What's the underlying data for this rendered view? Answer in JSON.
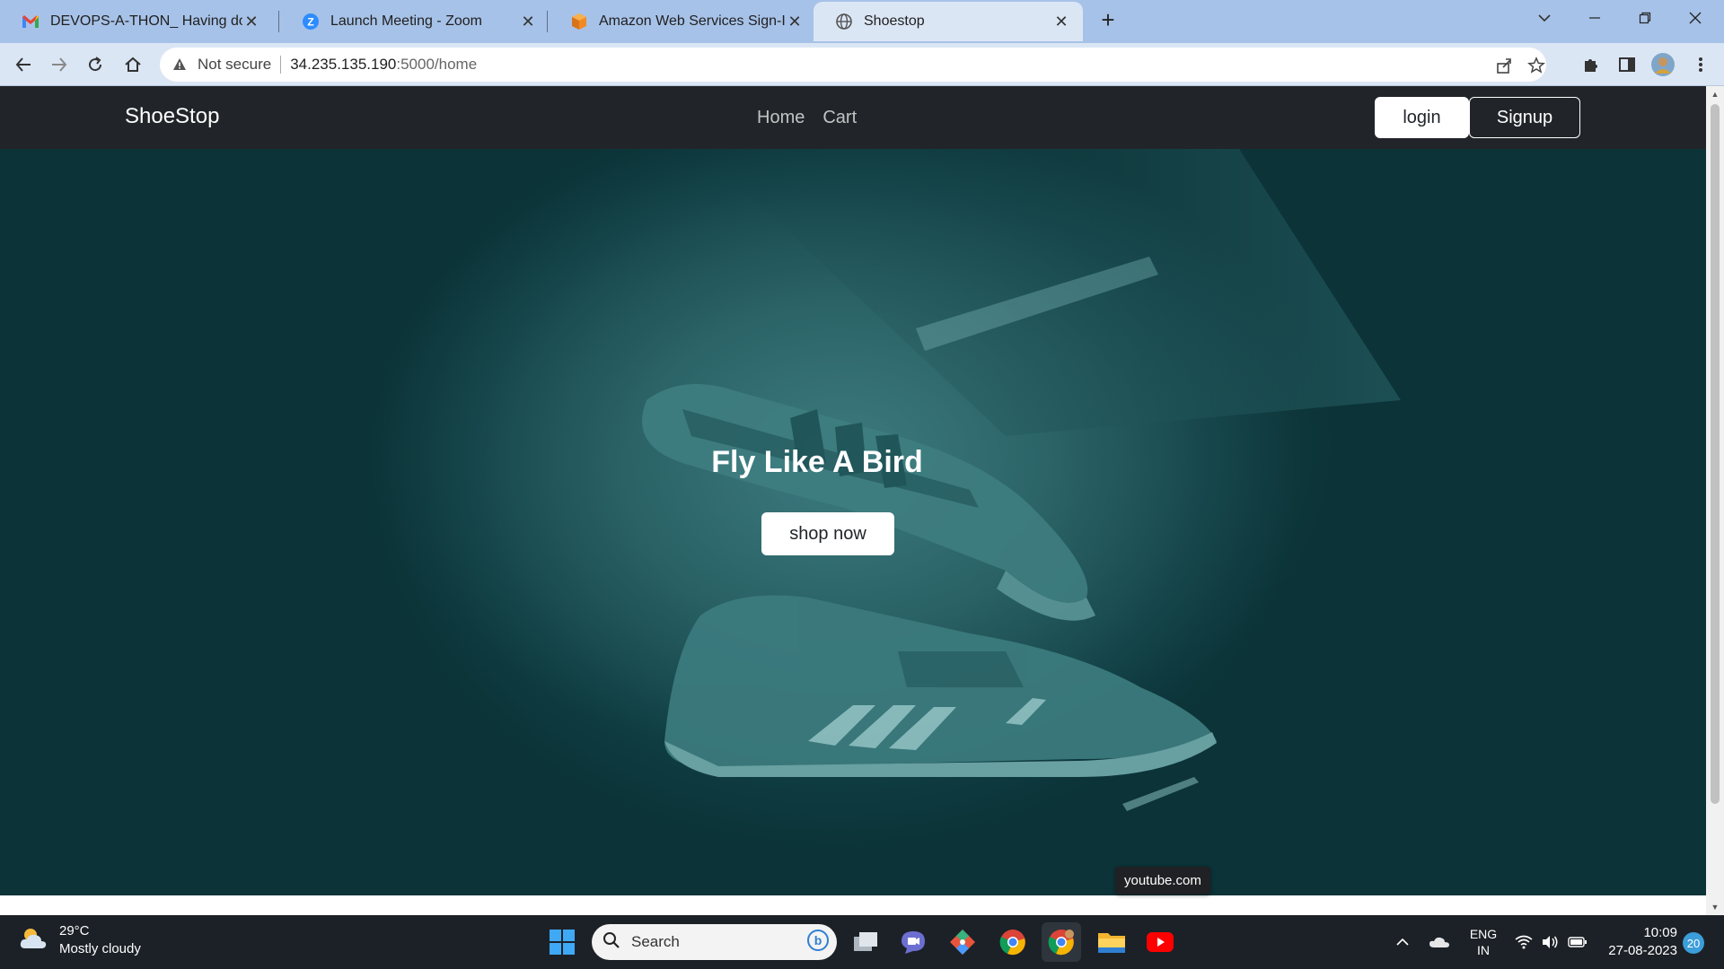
{
  "browser": {
    "tabs": [
      {
        "title": "DEVOPS-A-THON_ Having doubt",
        "icon": "gmail-icon"
      },
      {
        "title": "Launch Meeting - Zoom",
        "icon": "zoom-icon"
      },
      {
        "title": "Amazon Web Services Sign-In",
        "icon": "aws-icon"
      },
      {
        "title": "Shoestop",
        "icon": "globe-icon"
      }
    ],
    "address": {
      "security": "Not secure",
      "host": "34.235.135.190",
      "path": ":5000/home"
    }
  },
  "site": {
    "brand": "ShoeStop",
    "nav": {
      "home": "Home",
      "cart": "Cart"
    },
    "login": "login",
    "signup": "Signup",
    "hero": {
      "title": "Fly Like A Bird",
      "cta": "shop now"
    }
  },
  "status": {
    "hover_url": "youtube.com"
  },
  "taskbar": {
    "weather": {
      "temp": "29°C",
      "condition": "Mostly cloudy"
    },
    "search_placeholder": "Search",
    "language": {
      "lang": "ENG",
      "region": "IN"
    },
    "time": "10:09",
    "date": "27-08-2023",
    "notifications": "20"
  },
  "colors": {
    "navbar": "#212529",
    "hero": "#1f5559",
    "tabstrip": "#a7c2e8",
    "taskbar": "#1c2127"
  }
}
